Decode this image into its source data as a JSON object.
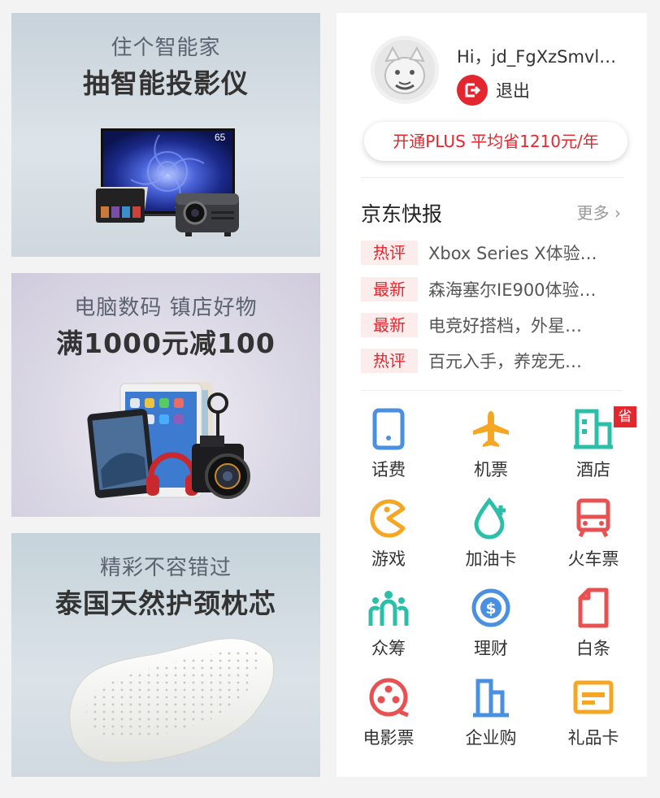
{
  "banners": [
    {
      "subtitle": "住个智能家",
      "title": "抽智能投影仪",
      "tv_badge": "65"
    },
    {
      "subtitle": "电脑数码 镇店好物",
      "title": "满1000元减100"
    },
    {
      "subtitle": "精彩不容错过",
      "title": "泰国天然护颈枕芯"
    }
  ],
  "user": {
    "greeting": "Hi，jd_FgXzSmvl…",
    "logout_label": "退出"
  },
  "plus": {
    "label": "开通PLUS 平均省1210元/年"
  },
  "news": {
    "title": "京东快报",
    "more_label": "更多 ›",
    "items": [
      {
        "tag": "热评",
        "text": "Xbox Series X体验…"
      },
      {
        "tag": "最新",
        "text": "森海塞尔IE900体验…"
      },
      {
        "tag": "最新",
        "text": "电竞好搭档，外星…"
      },
      {
        "tag": "热评",
        "text": "百元入手，养宠无…"
      }
    ]
  },
  "services": [
    {
      "label": "话费",
      "icon": "phone-icon",
      "color": "#4a90e2"
    },
    {
      "label": "机票",
      "icon": "airplane-icon",
      "color": "#f5a623"
    },
    {
      "label": "酒店",
      "icon": "hotel-icon",
      "color": "#2bbfaa"
    },
    {
      "label": "游戏",
      "icon": "game-icon",
      "color": "#f5a623"
    },
    {
      "label": "加油卡",
      "icon": "fuel-drop-icon",
      "color": "#2bbfaa"
    },
    {
      "label": "火车票",
      "icon": "train-icon",
      "color": "#e85151"
    },
    {
      "label": "众筹",
      "icon": "crowdfunding-icon",
      "color": "#2bbfaa"
    },
    {
      "label": "理财",
      "icon": "finance-icon",
      "color": "#4a90e2"
    },
    {
      "label": "白条",
      "icon": "document-icon",
      "color": "#e85151"
    },
    {
      "label": "电影票",
      "icon": "film-reel-icon",
      "color": "#e85151"
    },
    {
      "label": "企业购",
      "icon": "enterprise-icon",
      "color": "#4a90e2"
    },
    {
      "label": "礼品卡",
      "icon": "gift-card-icon",
      "color": "#f5a623"
    }
  ],
  "save_badge": "省",
  "colors": {
    "brand_red": "#e4262e",
    "background": "#f3f3f3"
  }
}
